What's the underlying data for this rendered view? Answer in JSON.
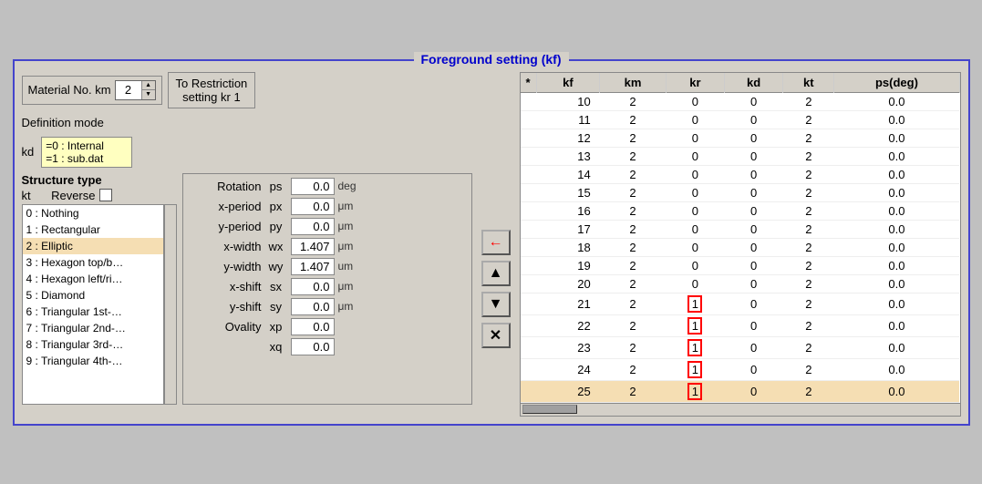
{
  "panel": {
    "title": "Foreground setting (kf)"
  },
  "material": {
    "label": "Material No. km",
    "value": "2"
  },
  "restriction": {
    "line1": "To Restriction",
    "line2": "setting  kr",
    "kr_value": "1"
  },
  "definition_mode": {
    "label": "Definition mode"
  },
  "kd": {
    "label": "kd",
    "options": [
      "=0 : Internal",
      "=1 : sub.dat"
    ]
  },
  "structure": {
    "type_label": "Structure type",
    "kt_label": "kt",
    "reverse_label": "Reverse",
    "items": [
      {
        "index": 0,
        "label": "0 : Nothing",
        "selected": false
      },
      {
        "index": 1,
        "label": "1 : Rectangular",
        "selected": false
      },
      {
        "index": 2,
        "label": "2 : Elliptic",
        "selected": true
      },
      {
        "index": 3,
        "label": "3 : Hexagon top/b…",
        "selected": false
      },
      {
        "index": 4,
        "label": "4 : Hexagon left/ri…",
        "selected": false
      },
      {
        "index": 5,
        "label": "5 : Diamond",
        "selected": false
      },
      {
        "index": 6,
        "label": "6 : Triangular 1st-…",
        "selected": false
      },
      {
        "index": 7,
        "label": "7 : Triangular 2nd-…",
        "selected": false
      },
      {
        "index": 8,
        "label": "8 : Triangular 3rd-…",
        "selected": false
      },
      {
        "index": 9,
        "label": "9 : Triangular 4th-…",
        "selected": false
      }
    ]
  },
  "params": [
    {
      "name": "Rotation",
      "short": "ps",
      "value": "0.0",
      "unit": "deg"
    },
    {
      "name": "x-period",
      "short": "px",
      "value": "0.0",
      "unit": "μm"
    },
    {
      "name": "y-period",
      "short": "py",
      "value": "0.0",
      "unit": "μm"
    },
    {
      "name": "x-width",
      "short": "wx",
      "value": "1.407",
      "unit": "μm"
    },
    {
      "name": "y-width",
      "short": "wy",
      "value": "1.407",
      "unit": "um"
    },
    {
      "name": "x-shift",
      "short": "sx",
      "value": "0.0",
      "unit": "μm"
    },
    {
      "name": "y-shift",
      "short": "sy",
      "value": "0.0",
      "unit": "μm"
    },
    {
      "name": "Ovality",
      "short": "xp",
      "value": "0.0",
      "unit": ""
    },
    {
      "name": "",
      "short": "xq",
      "value": "0.0",
      "unit": ""
    }
  ],
  "buttons": [
    {
      "label": "←",
      "color": "red",
      "name": "left-arrow-button"
    },
    {
      "label": "▲",
      "color": "black",
      "name": "up-arrow-button"
    },
    {
      "label": "▼",
      "color": "black",
      "name": "down-arrow-button"
    },
    {
      "label": "✕",
      "color": "black",
      "name": "x-button"
    }
  ],
  "table": {
    "headers": [
      "*",
      "kf",
      "km",
      "kr",
      "kd",
      "kt",
      "ps(deg)"
    ],
    "rows": [
      {
        "kf": "10",
        "km": "2",
        "kr": "0",
        "kd": "0",
        "kt": "2",
        "ps": "0.0",
        "highlighted": false,
        "kr_red": false
      },
      {
        "kf": "11",
        "km": "2",
        "kr": "0",
        "kd": "0",
        "kt": "2",
        "ps": "0.0",
        "highlighted": false,
        "kr_red": false
      },
      {
        "kf": "12",
        "km": "2",
        "kr": "0",
        "kd": "0",
        "kt": "2",
        "ps": "0.0",
        "highlighted": false,
        "kr_red": false
      },
      {
        "kf": "13",
        "km": "2",
        "kr": "0",
        "kd": "0",
        "kt": "2",
        "ps": "0.0",
        "highlighted": false,
        "kr_red": false
      },
      {
        "kf": "14",
        "km": "2",
        "kr": "0",
        "kd": "0",
        "kt": "2",
        "ps": "0.0",
        "highlighted": false,
        "kr_red": false
      },
      {
        "kf": "15",
        "km": "2",
        "kr": "0",
        "kd": "0",
        "kt": "2",
        "ps": "0.0",
        "highlighted": false,
        "kr_red": false
      },
      {
        "kf": "16",
        "km": "2",
        "kr": "0",
        "kd": "0",
        "kt": "2",
        "ps": "0.0",
        "highlighted": false,
        "kr_red": false
      },
      {
        "kf": "17",
        "km": "2",
        "kr": "0",
        "kd": "0",
        "kt": "2",
        "ps": "0.0",
        "highlighted": false,
        "kr_red": false
      },
      {
        "kf": "18",
        "km": "2",
        "kr": "0",
        "kd": "0",
        "kt": "2",
        "ps": "0.0",
        "highlighted": false,
        "kr_red": false
      },
      {
        "kf": "19",
        "km": "2",
        "kr": "0",
        "kd": "0",
        "kt": "2",
        "ps": "0.0",
        "highlighted": false,
        "kr_red": false
      },
      {
        "kf": "20",
        "km": "2",
        "kr": "0",
        "kd": "0",
        "kt": "2",
        "ps": "0.0",
        "highlighted": false,
        "kr_red": false
      },
      {
        "kf": "21",
        "km": "2",
        "kr": "1",
        "kd": "0",
        "kt": "2",
        "ps": "0.0",
        "highlighted": false,
        "kr_red": true
      },
      {
        "kf": "22",
        "km": "2",
        "kr": "1",
        "kd": "0",
        "kt": "2",
        "ps": "0.0",
        "highlighted": false,
        "kr_red": true
      },
      {
        "kf": "23",
        "km": "2",
        "kr": "1",
        "kd": "0",
        "kt": "2",
        "ps": "0.0",
        "highlighted": false,
        "kr_red": true
      },
      {
        "kf": "24",
        "km": "2",
        "kr": "1",
        "kd": "0",
        "kt": "2",
        "ps": "0.0",
        "highlighted": false,
        "kr_red": true
      },
      {
        "kf": "25",
        "km": "2",
        "kr": "1",
        "kd": "0",
        "kt": "2",
        "ps": "0.0",
        "highlighted": true,
        "kr_red": true
      }
    ]
  }
}
